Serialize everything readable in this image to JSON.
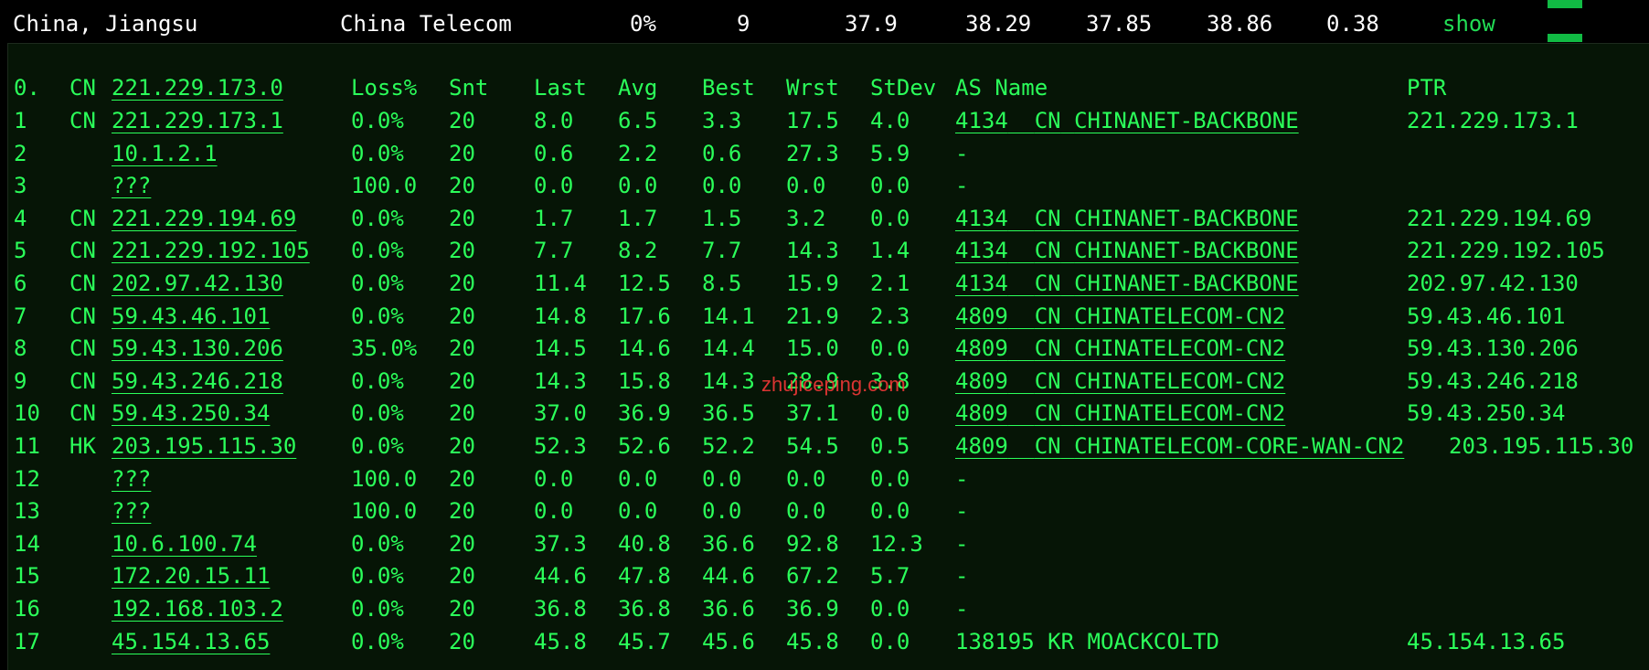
{
  "summary": {
    "location": "China, Jiangsu",
    "isp": "China Telecom",
    "loss": "0%",
    "sent": "9",
    "last": "37.9",
    "avg": "38.29",
    "best": "37.85",
    "worst": "38.86",
    "stdev": "0.38",
    "show_label": "show"
  },
  "headers": {
    "hop": "0.",
    "cc": "CN",
    "host": "221.229.173.0",
    "loss": "Loss%",
    "snt": "Snt",
    "last": "Last",
    "avg": "Avg",
    "best": "Best",
    "wrst": "Wrst",
    "stdev": "StDev",
    "as": "AS Name",
    "ptr": "PTR"
  },
  "hops": [
    {
      "n": "1",
      "cc": "CN",
      "host": "221.229.173.1",
      "loss": "0.0%",
      "snt": "20",
      "last": "8.0",
      "avg": "6.5",
      "best": "3.3",
      "wrst": "17.5",
      "stdev": "4.0",
      "asn": "4134",
      "ascc": "CN",
      "asname": "CHINANET-BACKBONE",
      "ptr": "221.229.173.1"
    },
    {
      "n": "2",
      "cc": "",
      "host": "10.1.2.1",
      "loss": "0.0%",
      "snt": "20",
      "last": "0.6",
      "avg": "2.2",
      "best": "0.6",
      "wrst": "27.3",
      "stdev": "5.9",
      "asn": "",
      "ascc": "",
      "asname": "-",
      "ptr": ""
    },
    {
      "n": "3",
      "cc": "",
      "host": "???",
      "loss": "100.0",
      "snt": "20",
      "last": "0.0",
      "avg": "0.0",
      "best": "0.0",
      "wrst": "0.0",
      "stdev": "0.0",
      "asn": "",
      "ascc": "",
      "asname": "-",
      "ptr": ""
    },
    {
      "n": "4",
      "cc": "CN",
      "host": "221.229.194.69",
      "loss": "0.0%",
      "snt": "20",
      "last": "1.7",
      "avg": "1.7",
      "best": "1.5",
      "wrst": "3.2",
      "stdev": "0.0",
      "asn": "4134",
      "ascc": "CN",
      "asname": "CHINANET-BACKBONE",
      "ptr": "221.229.194.69"
    },
    {
      "n": "5",
      "cc": "CN",
      "host": "221.229.192.105",
      "loss": "0.0%",
      "snt": "20",
      "last": "7.7",
      "avg": "8.2",
      "best": "7.7",
      "wrst": "14.3",
      "stdev": "1.4",
      "asn": "4134",
      "ascc": "CN",
      "asname": "CHINANET-BACKBONE",
      "ptr": "221.229.192.105"
    },
    {
      "n": "6",
      "cc": "CN",
      "host": "202.97.42.130",
      "loss": "0.0%",
      "snt": "20",
      "last": "11.4",
      "avg": "12.5",
      "best": "8.5",
      "wrst": "15.9",
      "stdev": "2.1",
      "asn": "4134",
      "ascc": "CN",
      "asname": "CHINANET-BACKBONE",
      "ptr": "202.97.42.130"
    },
    {
      "n": "7",
      "cc": "CN",
      "host": "59.43.46.101",
      "loss": "0.0%",
      "snt": "20",
      "last": "14.8",
      "avg": "17.6",
      "best": "14.1",
      "wrst": "21.9",
      "stdev": "2.3",
      "asn": "4809",
      "ascc": "CN",
      "asname": "CHINATELECOM-CN2",
      "ptr": "59.43.46.101"
    },
    {
      "n": "8",
      "cc": "CN",
      "host": "59.43.130.206",
      "loss": "35.0%",
      "snt": "20",
      "last": "14.5",
      "avg": "14.6",
      "best": "14.4",
      "wrst": "15.0",
      "stdev": "0.0",
      "asn": "4809",
      "ascc": "CN",
      "asname": "CHINATELECOM-CN2",
      "ptr": "59.43.130.206"
    },
    {
      "n": "9",
      "cc": "CN",
      "host": "59.43.246.218",
      "loss": "0.0%",
      "snt": "20",
      "last": "14.3",
      "avg": "15.8",
      "best": "14.3",
      "wrst": "28.9",
      "stdev": "3.8",
      "asn": "4809",
      "ascc": "CN",
      "asname": "CHINATELECOM-CN2",
      "ptr": "59.43.246.218"
    },
    {
      "n": "10",
      "cc": "CN",
      "host": "59.43.250.34",
      "loss": "0.0%",
      "snt": "20",
      "last": "37.0",
      "avg": "36.9",
      "best": "36.5",
      "wrst": "37.1",
      "stdev": "0.0",
      "asn": "4809",
      "ascc": "CN",
      "asname": "CHINATELECOM-CN2",
      "ptr": "59.43.250.34"
    },
    {
      "n": "11",
      "cc": "HK",
      "host": "203.195.115.30",
      "loss": "0.0%",
      "snt": "20",
      "last": "52.3",
      "avg": "52.6",
      "best": "52.2",
      "wrst": "54.5",
      "stdev": "0.5",
      "asn": "4809",
      "ascc": "CN",
      "asname": "CHINATELECOM-CORE-WAN-CN2",
      "ptr": "203.195.115.30"
    },
    {
      "n": "12",
      "cc": "",
      "host": "???",
      "loss": "100.0",
      "snt": "20",
      "last": "0.0",
      "avg": "0.0",
      "best": "0.0",
      "wrst": "0.0",
      "stdev": "0.0",
      "asn": "",
      "ascc": "",
      "asname": "-",
      "ptr": ""
    },
    {
      "n": "13",
      "cc": "",
      "host": "???",
      "loss": "100.0",
      "snt": "20",
      "last": "0.0",
      "avg": "0.0",
      "best": "0.0",
      "wrst": "0.0",
      "stdev": "0.0",
      "asn": "",
      "ascc": "",
      "asname": "-",
      "ptr": ""
    },
    {
      "n": "14",
      "cc": "",
      "host": "10.6.100.74",
      "loss": "0.0%",
      "snt": "20",
      "last": "37.3",
      "avg": "40.8",
      "best": "36.6",
      "wrst": "92.8",
      "stdev": "12.3",
      "asn": "",
      "ascc": "",
      "asname": "-",
      "ptr": ""
    },
    {
      "n": "15",
      "cc": "",
      "host": "172.20.15.11",
      "loss": "0.0%",
      "snt": "20",
      "last": "44.6",
      "avg": "47.8",
      "best": "44.6",
      "wrst": "67.2",
      "stdev": "5.7",
      "asn": "",
      "ascc": "",
      "asname": "-",
      "ptr": ""
    },
    {
      "n": "16",
      "cc": "",
      "host": "192.168.103.2",
      "loss": "0.0%",
      "snt": "20",
      "last": "36.8",
      "avg": "36.8",
      "best": "36.6",
      "wrst": "36.9",
      "stdev": "0.0",
      "asn": "",
      "ascc": "",
      "asname": "-",
      "ptr": ""
    },
    {
      "n": "17",
      "cc": "",
      "host": "45.154.13.65",
      "loss": "0.0%",
      "snt": "20",
      "last": "45.8",
      "avg": "45.7",
      "best": "45.6",
      "wrst": "45.8",
      "stdev": "0.0",
      "asn": "138195",
      "ascc": "KR",
      "asname": "MOACKCOLTD",
      "ptr": "45.154.13.65"
    }
  ],
  "watermark": "zhujiceping.com"
}
